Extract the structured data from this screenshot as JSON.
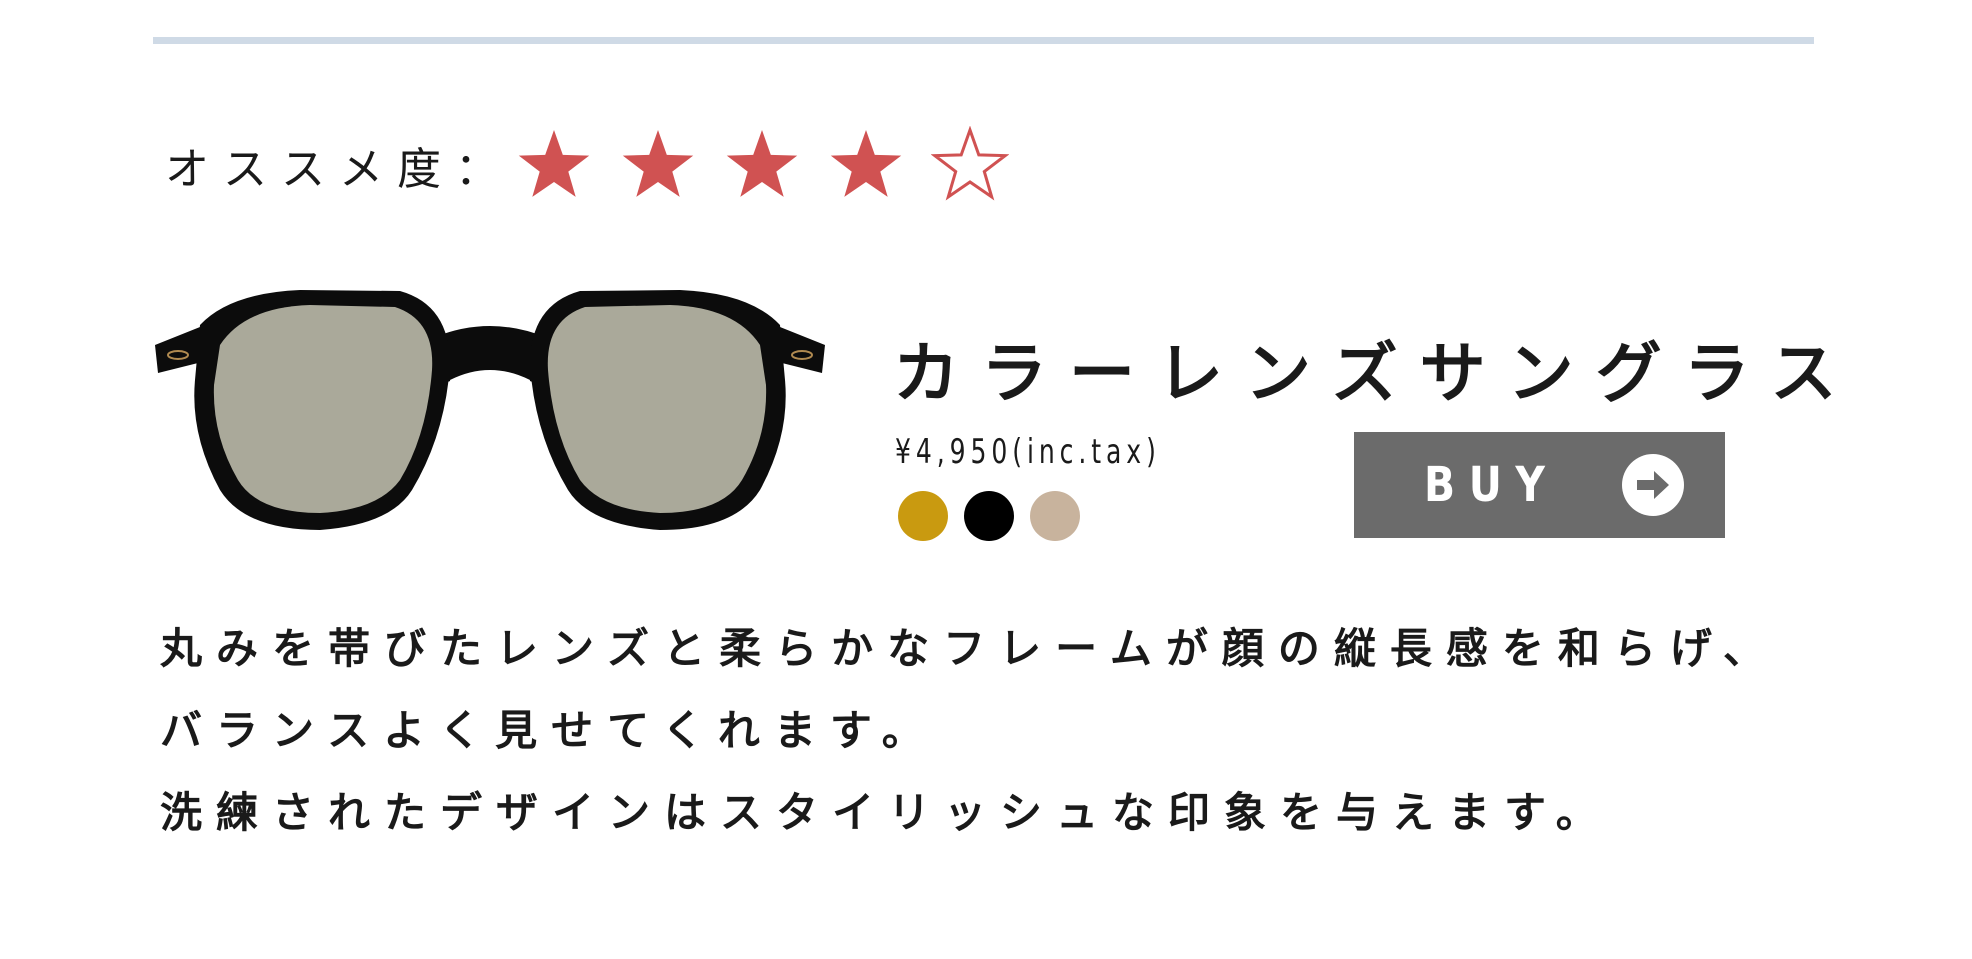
{
  "rating": {
    "label": "オススメ度：",
    "value": 4,
    "max": 5,
    "filled_color": "#d05252",
    "empty_stroke_color": "#d05252"
  },
  "product": {
    "image": "sunglasses-image",
    "name": "カラーレンズサングラス",
    "price": "¥4,950(inc.tax)",
    "color_options": [
      {
        "name": "yellow-swatch",
        "color": "#c99a10"
      },
      {
        "name": "black-swatch",
        "color": "#000000"
      },
      {
        "name": "beige-swatch",
        "color": "#c8b39d"
      }
    ],
    "buy_button": {
      "label": "BUY",
      "icon": "arrow-right-icon",
      "background": "#6b6b6b"
    }
  },
  "description": {
    "lines": [
      "丸みを帯びたレンズと柔らかなフレームが顔の縦長感を和らげ、",
      "バランスよく見せてくれます。",
      "洗練されたデザインはスタイリッシュな印象を与えます。"
    ]
  },
  "colors": {
    "divider": "#cfdae6",
    "text": "#1a1a1a"
  }
}
